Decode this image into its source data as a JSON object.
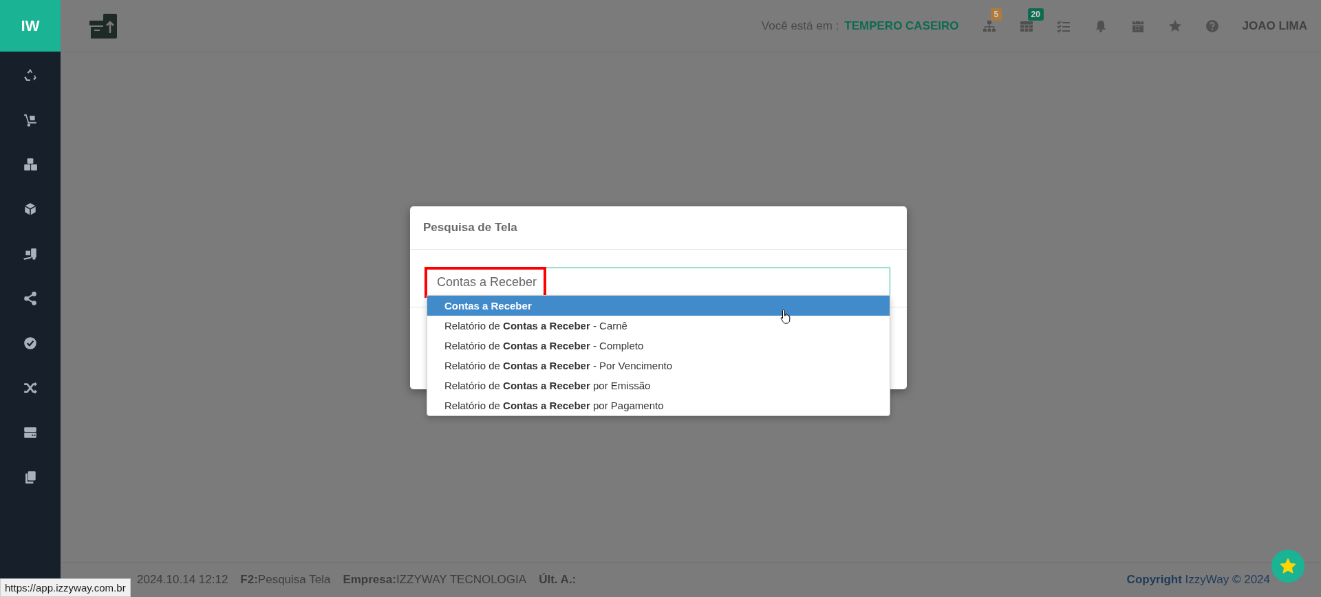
{
  "sidebar": {
    "logo": "IW"
  },
  "header": {
    "location_label": "Você está em :",
    "company": "TEMPERO CASEIRO",
    "badges": [
      {
        "count": "5",
        "color": "#b07a3c"
      },
      {
        "count": "20",
        "color": "#0f6b50"
      }
    ],
    "user": "JOAO LIMA"
  },
  "modal": {
    "title": "Pesquisa de Tela",
    "search": {
      "value": "Contas a Receber",
      "highlighted": true
    },
    "suggestions": [
      {
        "text": "Contas a Receber",
        "selected": true
      },
      {
        "text": "Relatório de **Contas a Receber** - Carnê",
        "selected": false
      },
      {
        "text": "Relatório de **Contas a Receber** - Completo",
        "selected": false
      },
      {
        "text": "Relatório de **Contas a Receber** - Por Vencimento",
        "selected": false
      },
      {
        "text": "Relatório de **Contas a Receber** por Emissão",
        "selected": false
      },
      {
        "text": "Relatório de **Contas a Receber** por Pagamento",
        "selected": false
      }
    ]
  },
  "footer": {
    "items": [
      {
        "value": "2024.10.14 12:12"
      },
      {
        "label": "F2:",
        "value": "Pesquisa Tela"
      },
      {
        "label": "Empresa:",
        "value": "IZZYWAY TECNOLOGIA"
      },
      {
        "label": "Últ. A.:"
      }
    ],
    "copyright": "**Copyright** IzzyWay © 2024"
  },
  "status_url": "https://app.izzyway.com.br"
}
